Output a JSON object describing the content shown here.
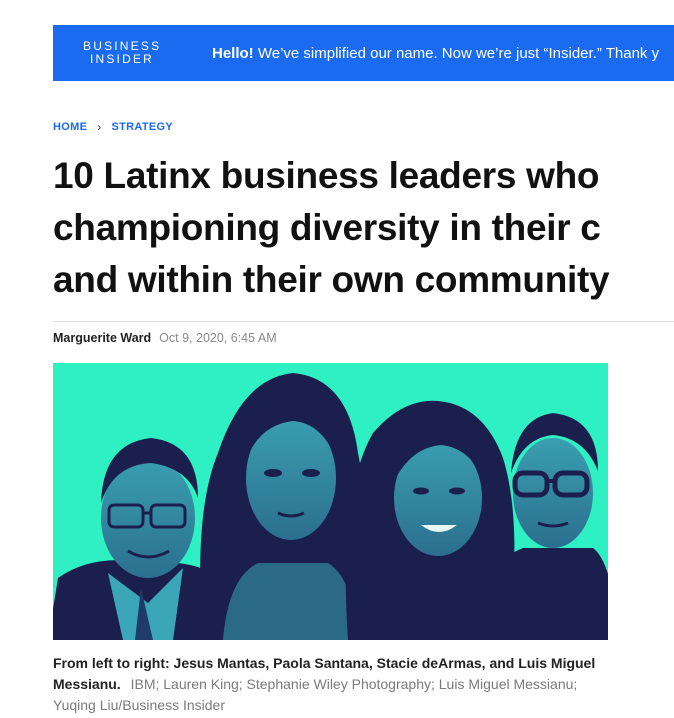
{
  "banner": {
    "logo_line1": "BUSINESS",
    "logo_line2": "INSIDER",
    "hello": "Hello!",
    "message": " We’ve simplified our name. Now we’re just “Insider.” Thank y"
  },
  "breadcrumb": {
    "home": "HOME",
    "separator": "›",
    "section": "STRATEGY"
  },
  "article": {
    "headline_lines": [
      "10 Latinx business leaders who",
      "championing diversity in their c",
      "and within their own community"
    ],
    "author": "Marguerite Ward",
    "date": "Oct 9, 2020, 6:45 AM"
  },
  "caption": {
    "text": "From left to right: Jesus Mantas, Paola Santana, Stacie deArmas, and Luis Miguel Messianu.",
    "credit": "IBM; Lauren King; Stephanie Wiley Photography; Luis Miguel Messianu; Yuqing Liu/Business Insider"
  },
  "colors": {
    "brand_blue": "#1a6bf0",
    "hero_teal": "#2ff0c2",
    "hero_navy": "#1b1f4d"
  }
}
